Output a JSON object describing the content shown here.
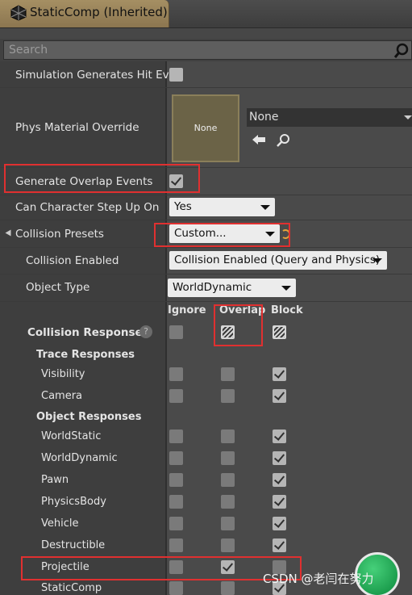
{
  "tab": {
    "title": "StaticComp (Inherited)"
  },
  "search": {
    "placeholder": "Search"
  },
  "properties": {
    "simulation_hit_events": "Simulation Generates Hit Eve",
    "phys_material_override": "Phys Material Override",
    "phys_material_thumb": "None",
    "phys_material_value": "None",
    "generate_overlap_events": "Generate Overlap Events",
    "can_character_step_up_on": "Can Character Step Up On",
    "can_character_step_up_value": "Yes",
    "collision_presets": "Collision Presets",
    "collision_presets_value": "Custom...",
    "collision_enabled": "Collision Enabled",
    "collision_enabled_value": "Collision Enabled (Query and Physics)",
    "object_type": "Object Type",
    "object_type_value": "WorldDynamic"
  },
  "responses": {
    "headers": {
      "ignore": "Ignore",
      "overlap": "Overlap",
      "block": "Block"
    },
    "collision_responses": "Collision Responses",
    "help_glyph": "?",
    "trace_responses": "Trace Responses",
    "object_responses": "Object Responses",
    "rows": [
      {
        "label": "Visibility",
        "ignore": false,
        "overlap": false,
        "block": true
      },
      {
        "label": "Camera",
        "ignore": false,
        "overlap": false,
        "block": true
      },
      {
        "label": "WorldStatic",
        "ignore": false,
        "overlap": false,
        "block": true
      },
      {
        "label": "WorldDynamic",
        "ignore": false,
        "overlap": false,
        "block": true
      },
      {
        "label": "Pawn",
        "ignore": false,
        "overlap": false,
        "block": true
      },
      {
        "label": "PhysicsBody",
        "ignore": false,
        "overlap": false,
        "block": true
      },
      {
        "label": "Vehicle",
        "ignore": false,
        "overlap": false,
        "block": true
      },
      {
        "label": "Destructible",
        "ignore": false,
        "overlap": false,
        "block": true
      },
      {
        "label": "Projectile",
        "ignore": false,
        "overlap": true,
        "block": false
      },
      {
        "label": "StaticComp",
        "ignore": false,
        "overlap": false,
        "block": true
      }
    ]
  },
  "watermark": "CSDN @老闫在努力",
  "colors": {
    "highlight": "#e03030",
    "tab": "#a58f63"
  }
}
